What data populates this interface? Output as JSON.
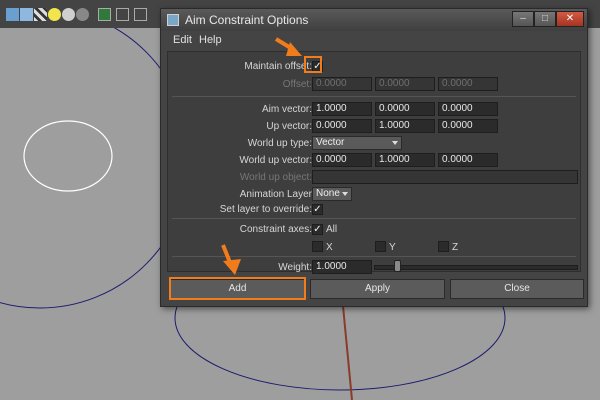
{
  "window": {
    "title": "Aim Constraint Options"
  },
  "menu": {
    "items": [
      "Edit",
      "Help"
    ]
  },
  "options": {
    "maintain_offset_label": "Maintain offset:",
    "offset_label": "Offset:",
    "offset_values": [
      "0.0000",
      "0.0000",
      "0.0000"
    ],
    "aim_vector_label": "Aim vector:",
    "aim_vector_values": [
      "1.0000",
      "0.0000",
      "0.0000"
    ],
    "up_vector_label": "Up vector:",
    "up_vector_values": [
      "0.0000",
      "1.0000",
      "0.0000"
    ],
    "world_up_type_label": "World up type:",
    "world_up_type_value": "Vector",
    "world_up_vector_label": "World up vector:",
    "world_up_vector_values": [
      "0.0000",
      "1.0000",
      "0.0000"
    ],
    "world_up_object_label": "World up object:",
    "animation_layer_label": "Animation Layer",
    "animation_layer_value": "None",
    "set_layer_label": "Set layer to override:",
    "constraint_axes_label": "Constraint axes:",
    "axis_all_label": "All",
    "axis_x_label": "X",
    "axis_y_label": "Y",
    "axis_z_label": "Z",
    "weight_label": "Weight:",
    "weight_value": "1.0000",
    "weight_slider_fraction": 0.1
  },
  "buttons": {
    "add": "Add",
    "apply": "Apply",
    "close": "Close"
  },
  "checkmark": "✓",
  "colors": {
    "highlight": "#f07c1b",
    "dialog_bg": "#444444"
  }
}
